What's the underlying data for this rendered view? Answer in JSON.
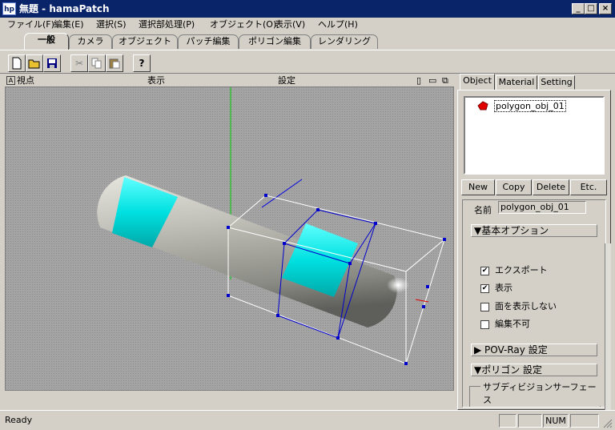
{
  "window": {
    "app_icon": "hp",
    "title": "無題 - hamaPatch",
    "minimize": "_",
    "maximize": "□",
    "close": "×"
  },
  "menu": [
    "ファイル(F)",
    "編集(E)",
    "選択(S)",
    "選択部処理(P)",
    "オブジェクト(O)",
    "表示(V)",
    "ヘルプ(H)"
  ],
  "tabs": [
    "一般",
    "カメラ",
    "オブジェクト",
    "パッチ編集",
    "ポリゴン編集",
    "レンダリング"
  ],
  "toolbar": {
    "icons": [
      "new-file-icon",
      "open-folder-icon",
      "save-icon",
      "cut-icon",
      "copy-icon",
      "paste-icon",
      "help-icon"
    ],
    "help_glyph": "?"
  },
  "viewport_header": {
    "view_label": "視点",
    "display_label": "表示",
    "settings_label": "設定"
  },
  "right_panel": {
    "tabs": [
      "Object",
      "Material",
      "Setting"
    ],
    "object_item": "polygon_obj_01",
    "buttons": [
      "New",
      "Copy",
      "Delete",
      "Etc."
    ],
    "name_label": "名前",
    "name_value": "polygon_obj_01",
    "basic_options": "▼基本オプション",
    "checkboxes": [
      {
        "label": "エクスポート",
        "checked": true
      },
      {
        "label": "表示",
        "checked": true
      },
      {
        "label": "面を表示しない",
        "checked": false
      },
      {
        "label": "編集不可",
        "checked": false
      }
    ],
    "povray": "▶ POV-Ray 設定",
    "polygon": "▼ポリゴン 設定",
    "subdiv": "サブディビジョンサーフェース"
  },
  "status": {
    "text": "Ready",
    "num": "NUM"
  },
  "colors": {
    "title_bg": "#0a246a",
    "viewport_bg": "#a8a8a8",
    "capsule": "#b8b8b0",
    "band": "#00e0e0",
    "selection": "#0000cc"
  }
}
